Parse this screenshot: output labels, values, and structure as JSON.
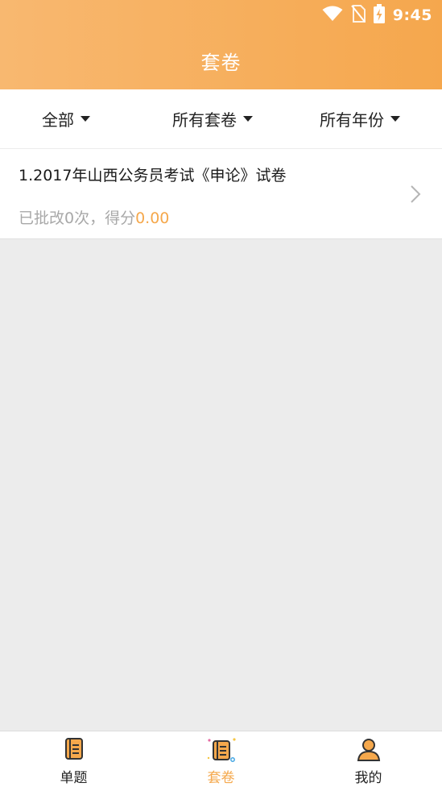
{
  "status_bar": {
    "time": "9:45",
    "icons": [
      "wifi-icon",
      "no-sim-icon",
      "battery-charging-icon"
    ]
  },
  "header": {
    "title": "套卷"
  },
  "filters": [
    {
      "label": "全部",
      "icon": "caret-down-icon"
    },
    {
      "label": "所有套卷",
      "icon": "caret-down-icon"
    },
    {
      "label": "所有年份",
      "icon": "caret-down-icon"
    }
  ],
  "list": {
    "items": [
      {
        "title": "1.2017年山西公务员考试《申论》试卷",
        "subtitle_prefix": "已批改0次，得分",
        "score": "0.00",
        "icon": "chevron-right-icon"
      }
    ]
  },
  "tabs": [
    {
      "label": "单题",
      "icon": "book-icon",
      "active": false
    },
    {
      "label": "套卷",
      "icon": "book-sparkle-icon",
      "active": true
    },
    {
      "label": "我的",
      "icon": "user-icon",
      "active": false
    }
  ],
  "colors": {
    "accent": "#f5a84c",
    "header_start": "#f8b870",
    "header_end": "#f5a74d",
    "background": "#ececec"
  }
}
